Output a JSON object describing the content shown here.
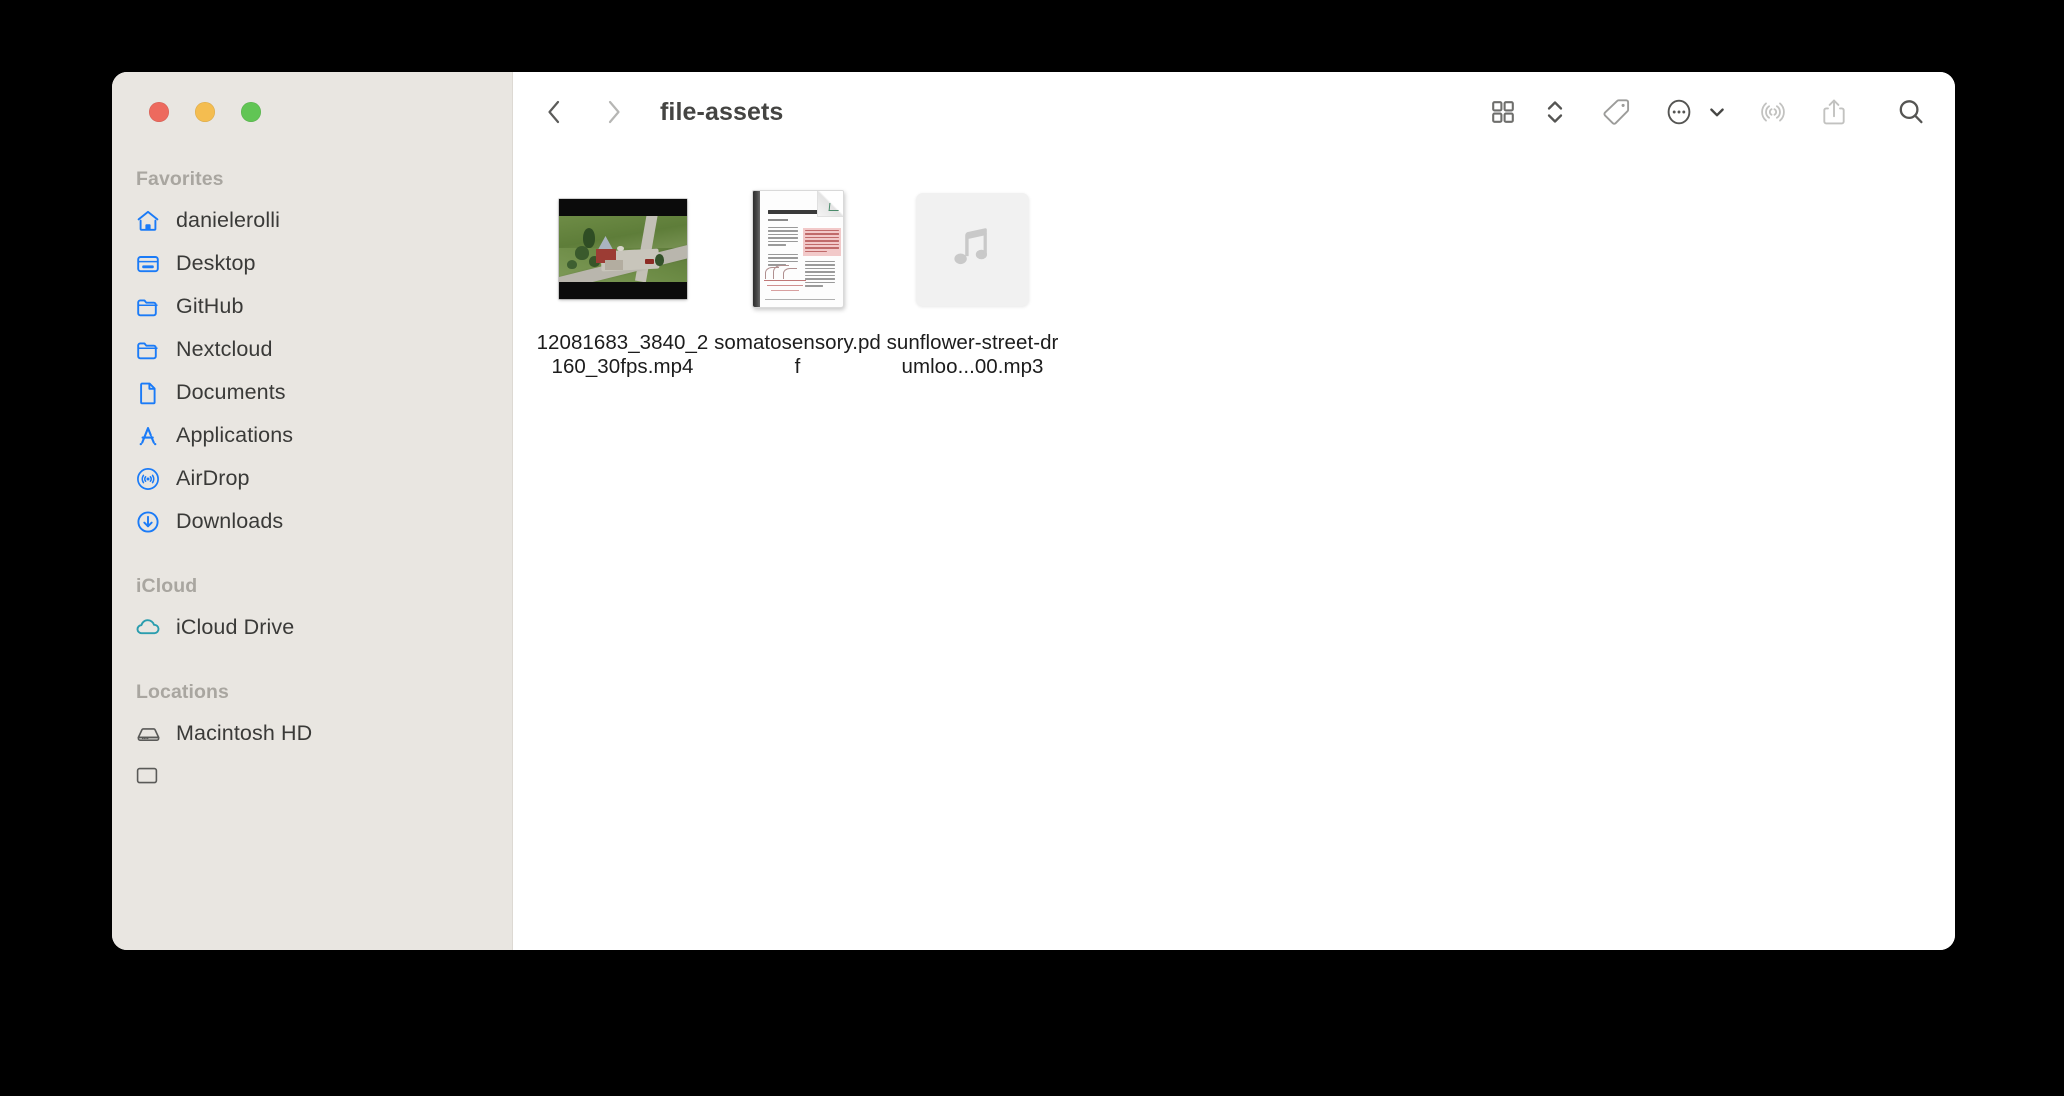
{
  "window": {
    "title": "file-assets",
    "traffic_lights": [
      {
        "name": "close",
        "color": "#ED6A5E"
      },
      {
        "name": "minimize",
        "color": "#F4BD50"
      },
      {
        "name": "maximize",
        "color": "#61C554"
      }
    ]
  },
  "toolbar": {
    "back_icon": "chevron-left-icon",
    "forward_icon": "chevron-right-icon",
    "back_enabled": true,
    "forward_enabled": false,
    "items": [
      {
        "icon": "grid-view-icon",
        "label": "Icon View"
      },
      {
        "icon": "view-stepper-icon",
        "label": "Change View Options"
      },
      {
        "icon": "tag-icon",
        "label": "Edit Tags"
      },
      {
        "icon": "ellipsis-circle-icon",
        "label": "More"
      },
      {
        "icon": "chevron-down-icon",
        "label": "More Menu"
      },
      {
        "icon": "airdrop-icon",
        "label": "AirDrop"
      },
      {
        "icon": "share-icon",
        "label": "Share"
      },
      {
        "icon": "search-icon",
        "label": "Search"
      }
    ]
  },
  "sidebar": {
    "sections": [
      {
        "title": "Favorites",
        "items": [
          {
            "label": "danielerolli",
            "icon": "home-icon",
            "color": "#1B7BF7"
          },
          {
            "label": "Desktop",
            "icon": "desktop-icon",
            "color": "#1B7BF7"
          },
          {
            "label": "GitHub",
            "icon": "folder-icon",
            "color": "#1B7BF7"
          },
          {
            "label": "Nextcloud",
            "icon": "folder-icon",
            "color": "#1B7BF7"
          },
          {
            "label": "Documents",
            "icon": "document-icon",
            "color": "#1B7BF7"
          },
          {
            "label": "Applications",
            "icon": "applications-icon",
            "color": "#1B7BF7"
          },
          {
            "label": "AirDrop",
            "icon": "airdrop-icon",
            "color": "#1B7BF7"
          },
          {
            "label": "Downloads",
            "icon": "downloads-icon",
            "color": "#1B7BF7"
          }
        ]
      },
      {
        "title": "iCloud",
        "items": [
          {
            "label": "iCloud Drive",
            "icon": "cloud-icon",
            "color": "#2A9DAE"
          }
        ]
      },
      {
        "title": "Locations",
        "items": [
          {
            "label": "Macintosh HD",
            "icon": "hard-disk-icon",
            "color": "#5A5A58"
          }
        ]
      }
    ]
  },
  "files": [
    {
      "name": "12081683_3840_2160_30fps.mp4",
      "kind": "video",
      "thumbnail": "aerial-farm-video-frame"
    },
    {
      "name": "somatosensory.pdf",
      "kind": "pdf",
      "thumbnail": "document-page-preview",
      "preview_title": "Anatomy of the Somatosensory",
      "highlight_color": "#F2C9C9"
    },
    {
      "name": "sunflower-street-drumloo...00.mp3",
      "kind": "audio",
      "thumbnail": "music-note-icon"
    }
  ],
  "colors": {
    "sidebar_bg": "#E9E6E1",
    "main_bg": "#FFFFFF",
    "accent_blue": "#1B7BF7",
    "section_header": "#A9A6A0",
    "label_text": "#3A3A38",
    "desktop_bg": "#000000"
  }
}
